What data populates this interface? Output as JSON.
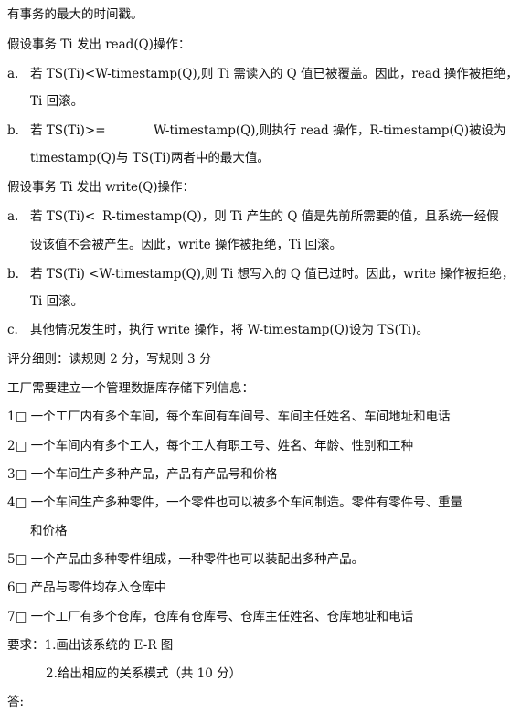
{
  "lines": [
    "有事务的最大的时间戳。",
    "假设事务 Ti 发出 read(Q)操作：",
    "a.",
    "若 TS(Ti)<W-timestamp(Q),则 Ti 需读入的 Q 值已被覆盖。因此，read 操作被拒绝，",
    "Ti 回滚。",
    "b.",
    "若 TS(Ti)>=",
    "W-timestamp(Q),则执行 read 操作，R-timestamp(Q)被设为 R-",
    "timestamp(Q)与 TS(Ti)两者中的最大值。",
    "假设事务 Ti 发出 write(Q)操作：",
    "a.",
    "若 TS(Ti)<",
    "R-timestamp(Q)，则 Ti 产生的 Q 值是先前所需要的值，且系统一经假",
    "设该值不会被产生。因此，write 操作被拒绝，Ti 回滚。",
    "b.",
    "若 TS(Ti) <W-timestamp(Q),则 Ti 想写入的 Q 值已过时。因此，write 操作被拒绝，",
    "Ti 回滚。",
    "c.",
    "其他情况发生时，执行 write 操作，将 W-timestamp(Q)设为 TS(Ti)。",
    "评分细则：读规则 2 分，写规则 3 分",
    "工厂需要建立一个管理数据库存储下列信息：",
    "1□ 一个工厂内有多个车间，每个车间有车间号、车间主任姓名、车间地址和电话",
    "2□ 一个车间内有多个工人，每个工人有职工号、姓名、年龄、性别和工种",
    "3□ 一个车间生产多种产品，产品有产品号和价格",
    "4□ 一个车间生产多种零件，一个零件也可以被多个车间制造。零件有零件号、重量",
    "和价格",
    "5□ 一个产品由多种零件组成，一种零件也可以装配出多种产品。",
    "6□ 产品与零件均存入仓库中",
    "7□ 一个工厂有多个仓库，仓库有仓库号、仓库主任姓名、仓库地址和电话",
    "要求：1.画出该系统的 E-R 图",
    "2.给出相应的关系模式（共 10 分）",
    "答:"
  ]
}
